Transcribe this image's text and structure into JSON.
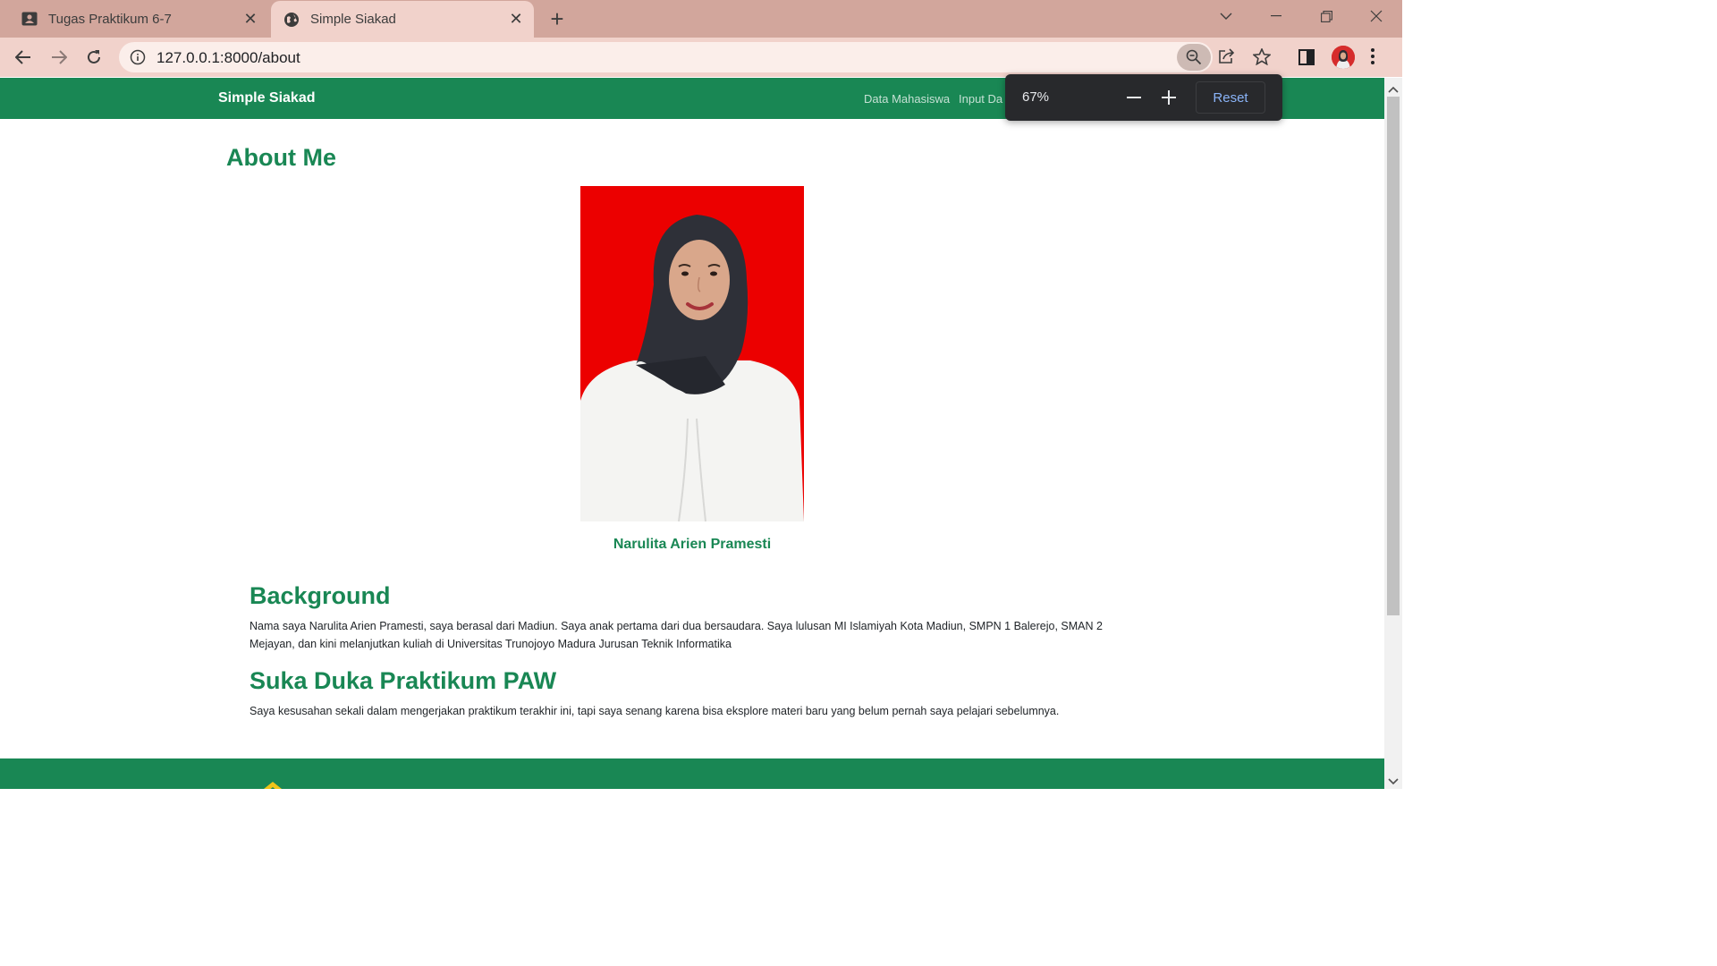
{
  "browser": {
    "tabs": [
      {
        "title": "Tugas Praktikum 6-7",
        "icon": "classroom-icon",
        "active": false
      },
      {
        "title": "Simple Siakad",
        "icon": "globe-icon",
        "active": true
      }
    ],
    "url": "127.0.0.1:8000/about",
    "colors": {
      "tabbar": "#d2a69c",
      "toolbar": "#f1d2cb"
    }
  },
  "zoom_popup": {
    "level": "67%",
    "reset_label": "Reset"
  },
  "site": {
    "brand": "Simple Siakad",
    "nav": [
      {
        "label": "Data Mahasiswa"
      },
      {
        "label": "Input Da"
      }
    ],
    "accent_color": "#198754"
  },
  "about": {
    "heading": "About Me",
    "photo_caption": "Narulita Arien Pramesti",
    "sections": [
      {
        "heading": "Background",
        "text": "Nama saya Narulita Arien Pramesti, saya berasal dari Madiun. Saya anak pertama dari dua bersaudara. Saya lulusan MI Islamiyah Kota Madiun, SMPN 1 Balerejo, SMAN 2 Mejayan, dan kini melanjutkan kuliah di Universitas Trunojoyo Madura Jurusan Teknik Informatika"
      },
      {
        "heading": "Suka Duka Praktikum PAW",
        "text": "Saya kesusahan sekali dalam mengerjakan praktikum terakhir ini, tapi saya senang karena bisa eksplore materi baru yang belum pernah saya pelajari sebelumnya."
      }
    ]
  }
}
